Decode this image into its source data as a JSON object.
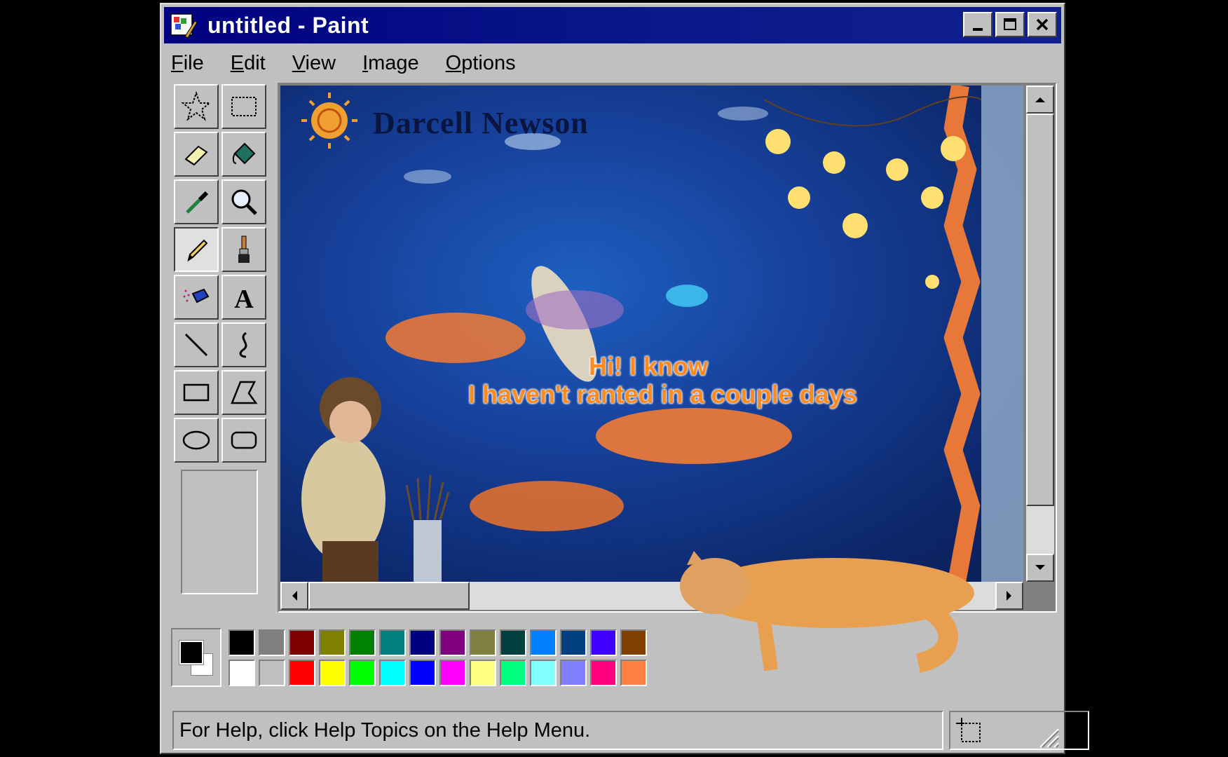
{
  "window": {
    "title": "untitled - Paint",
    "buttons": [
      "minimize",
      "maximize",
      "close"
    ]
  },
  "menu": {
    "items": [
      {
        "label": "File",
        "accel": "F",
        "rest": "ile"
      },
      {
        "label": "Edit",
        "accel": "E",
        "rest": "dit"
      },
      {
        "label": "View",
        "accel": "V",
        "rest": "iew"
      },
      {
        "label": "Image",
        "accel": "I",
        "rest": "mage"
      },
      {
        "label": "Options",
        "accel": "O",
        "rest": "ptions"
      }
    ]
  },
  "tools": [
    {
      "name": "free-form-select",
      "icon": "star-select-icon"
    },
    {
      "name": "rect-select",
      "icon": "rect-select-icon"
    },
    {
      "name": "eraser",
      "icon": "eraser-icon"
    },
    {
      "name": "fill",
      "icon": "paint-bucket-icon"
    },
    {
      "name": "pick-color",
      "icon": "eyedropper-icon"
    },
    {
      "name": "magnifier",
      "icon": "magnifier-icon"
    },
    {
      "name": "pencil",
      "icon": "pencil-icon",
      "active": true
    },
    {
      "name": "brush",
      "icon": "brush-icon"
    },
    {
      "name": "airbrush",
      "icon": "airbrush-icon"
    },
    {
      "name": "text",
      "icon": "text-icon"
    },
    {
      "name": "line",
      "icon": "line-icon"
    },
    {
      "name": "curve",
      "icon": "curve-icon"
    },
    {
      "name": "rectangle",
      "icon": "rectangle-icon"
    },
    {
      "name": "polygon",
      "icon": "polygon-icon"
    },
    {
      "name": "ellipse",
      "icon": "ellipse-icon"
    },
    {
      "name": "rounded-rectangle",
      "icon": "rounded-rect-icon"
    }
  ],
  "canvas": {
    "signature": "Darcell Newson",
    "caption_line1": "Hi! I know",
    "caption_line2": "I haven't ranted in a couple days"
  },
  "palette": {
    "foreground": "#000000",
    "background": "#ffffff",
    "top_row": [
      "#000000",
      "#808080",
      "#800000",
      "#808000",
      "#008000",
      "#008080",
      "#000080",
      "#800080",
      "#808040",
      "#004040",
      "#0080ff",
      "#004080",
      "#4000ff",
      "#804000"
    ],
    "bottom_row": [
      "#ffffff",
      "#c0c0c0",
      "#ff0000",
      "#ffff00",
      "#00ff00",
      "#00ffff",
      "#0000ff",
      "#ff00ff",
      "#ffff80",
      "#00ff80",
      "#80ffff",
      "#8080ff",
      "#ff0080",
      "#ff8040"
    ]
  },
  "status": {
    "help_text": "For Help, click Help Topics on the Help Menu."
  }
}
